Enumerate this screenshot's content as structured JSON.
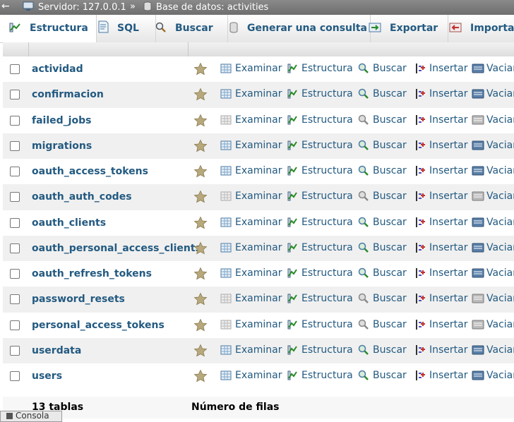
{
  "breadcrumb": {
    "back_glyph": "←",
    "server": "Servidor: 127.0.0.1",
    "separator": "»",
    "database": "Base de datos: activities"
  },
  "tabs": [
    {
      "label": "Estructura",
      "icon": "structure-icon",
      "active": true
    },
    {
      "label": "SQL",
      "icon": "sql-icon",
      "active": false
    },
    {
      "label": "Buscar",
      "icon": "search-icon",
      "active": false
    },
    {
      "label": "Generar una consulta",
      "icon": "query-icon",
      "active": false
    },
    {
      "label": "Exportar",
      "icon": "export-icon",
      "active": false
    },
    {
      "label": "Importar",
      "icon": "import-icon",
      "active": false
    }
  ],
  "actions": {
    "browse": "Examinar",
    "structure": "Estructura",
    "search": "Buscar",
    "insert": "Insertar",
    "empty": "Vaciar"
  },
  "tables": [
    {
      "name": "actividad",
      "empty": false
    },
    {
      "name": "confirmacion",
      "empty": false
    },
    {
      "name": "failed_jobs",
      "empty": true
    },
    {
      "name": "migrations",
      "empty": false
    },
    {
      "name": "oauth_access_tokens",
      "empty": false
    },
    {
      "name": "oauth_auth_codes",
      "empty": true
    },
    {
      "name": "oauth_clients",
      "empty": false
    },
    {
      "name": "oauth_personal_access_clients",
      "empty": false
    },
    {
      "name": "oauth_refresh_tokens",
      "empty": false
    },
    {
      "name": "password_resets",
      "empty": true
    },
    {
      "name": "personal_access_tokens",
      "empty": true
    },
    {
      "name": "userdata",
      "empty": false
    },
    {
      "name": "users",
      "empty": false
    }
  ],
  "footer": {
    "table_count": "13 tablas",
    "rows_label": "Número de filas"
  },
  "console": {
    "label": "Consola"
  },
  "colors": {
    "link": "#235a81",
    "star": "#b5a77a"
  }
}
